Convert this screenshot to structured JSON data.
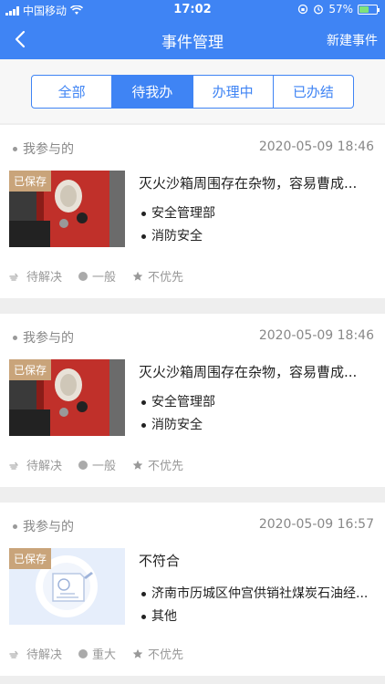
{
  "status_bar": {
    "carrier": "中国移动",
    "time": "17:02",
    "battery": "57%",
    "battery_level": 0.57
  },
  "nav": {
    "title": "事件管理",
    "action": "新建事件"
  },
  "tabs": [
    {
      "label": "全部",
      "active": false
    },
    {
      "label": "待我办",
      "active": true
    },
    {
      "label": "办理中",
      "active": false
    },
    {
      "label": "已办结",
      "active": false
    }
  ],
  "cards": [
    {
      "source": "我参与的",
      "time": "2020-05-09 18:46",
      "badge": "已保存",
      "title": "灭火沙箱周围存在杂物，容易曹成...",
      "tags": [
        "安全管理部",
        "消防安全"
      ],
      "status": "待解决",
      "level": "一般",
      "priority": "不优先",
      "image": "photo"
    },
    {
      "source": "我参与的",
      "time": "2020-05-09 18:46",
      "badge": "已保存",
      "title": "灭火沙箱周围存在杂物，容易曹成...",
      "tags": [
        "安全管理部",
        "消防安全"
      ],
      "status": "待解决",
      "level": "一般",
      "priority": "不优先",
      "image": "photo"
    },
    {
      "source": "我参与的",
      "time": "2020-05-09 16:57",
      "badge": "已保存",
      "title": "不符合",
      "tags": [
        "济南市历城区仲宫供销社煤炭石油经...",
        "其他"
      ],
      "status": "待解决",
      "level": "重大",
      "priority": "不优先",
      "image": "placeholder"
    }
  ]
}
